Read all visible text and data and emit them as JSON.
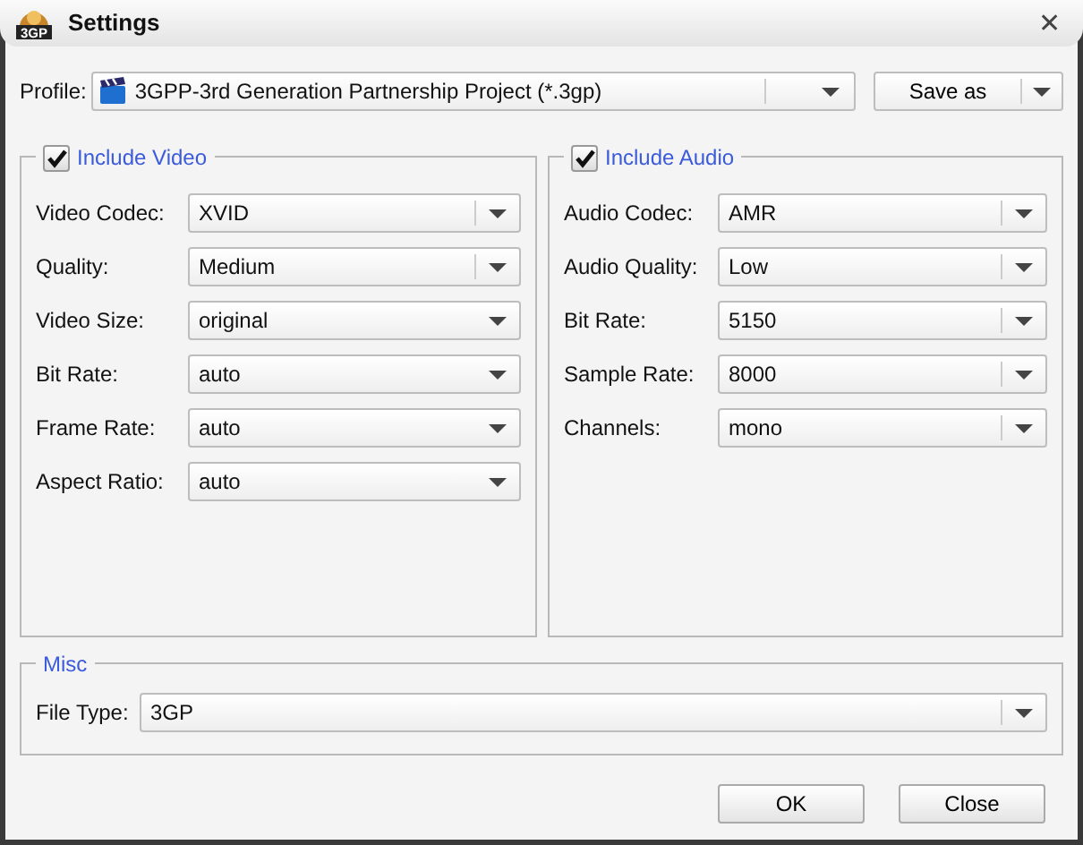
{
  "window": {
    "title": "Settings",
    "icon_text": "3GP",
    "close": "✕"
  },
  "profile": {
    "label": "Profile:",
    "value": "3GPP-3rd Generation Partnership Project (*.3gp)",
    "save_button": "Save as"
  },
  "video": {
    "title": "Include Video",
    "checked": true,
    "fields": [
      {
        "label": "Video Codec:",
        "value": "XVID",
        "split": true
      },
      {
        "label": "Quality:",
        "value": "Medium",
        "split": true
      },
      {
        "label": "Video Size:",
        "value": "original",
        "split": false
      },
      {
        "label": "Bit Rate:",
        "value": "auto",
        "split": false
      },
      {
        "label": "Frame Rate:",
        "value": "auto",
        "split": false
      },
      {
        "label": "Aspect Ratio:",
        "value": "auto",
        "split": false
      }
    ]
  },
  "audio": {
    "title": "Include Audio",
    "checked": true,
    "fields": [
      {
        "label": "Audio Codec:",
        "value": "AMR",
        "split": true
      },
      {
        "label": "Audio Quality:",
        "value": "Low",
        "split": true
      },
      {
        "label": "Bit Rate:",
        "value": "5150",
        "split": true
      },
      {
        "label": "Sample Rate:",
        "value": "8000",
        "split": true
      },
      {
        "label": "Channels:",
        "value": "mono",
        "split": true
      }
    ]
  },
  "misc": {
    "title": "Misc",
    "fields": [
      {
        "label": "File Type:",
        "value": "3GP",
        "split": true
      }
    ]
  },
  "buttons": [
    "OK",
    "Close"
  ]
}
